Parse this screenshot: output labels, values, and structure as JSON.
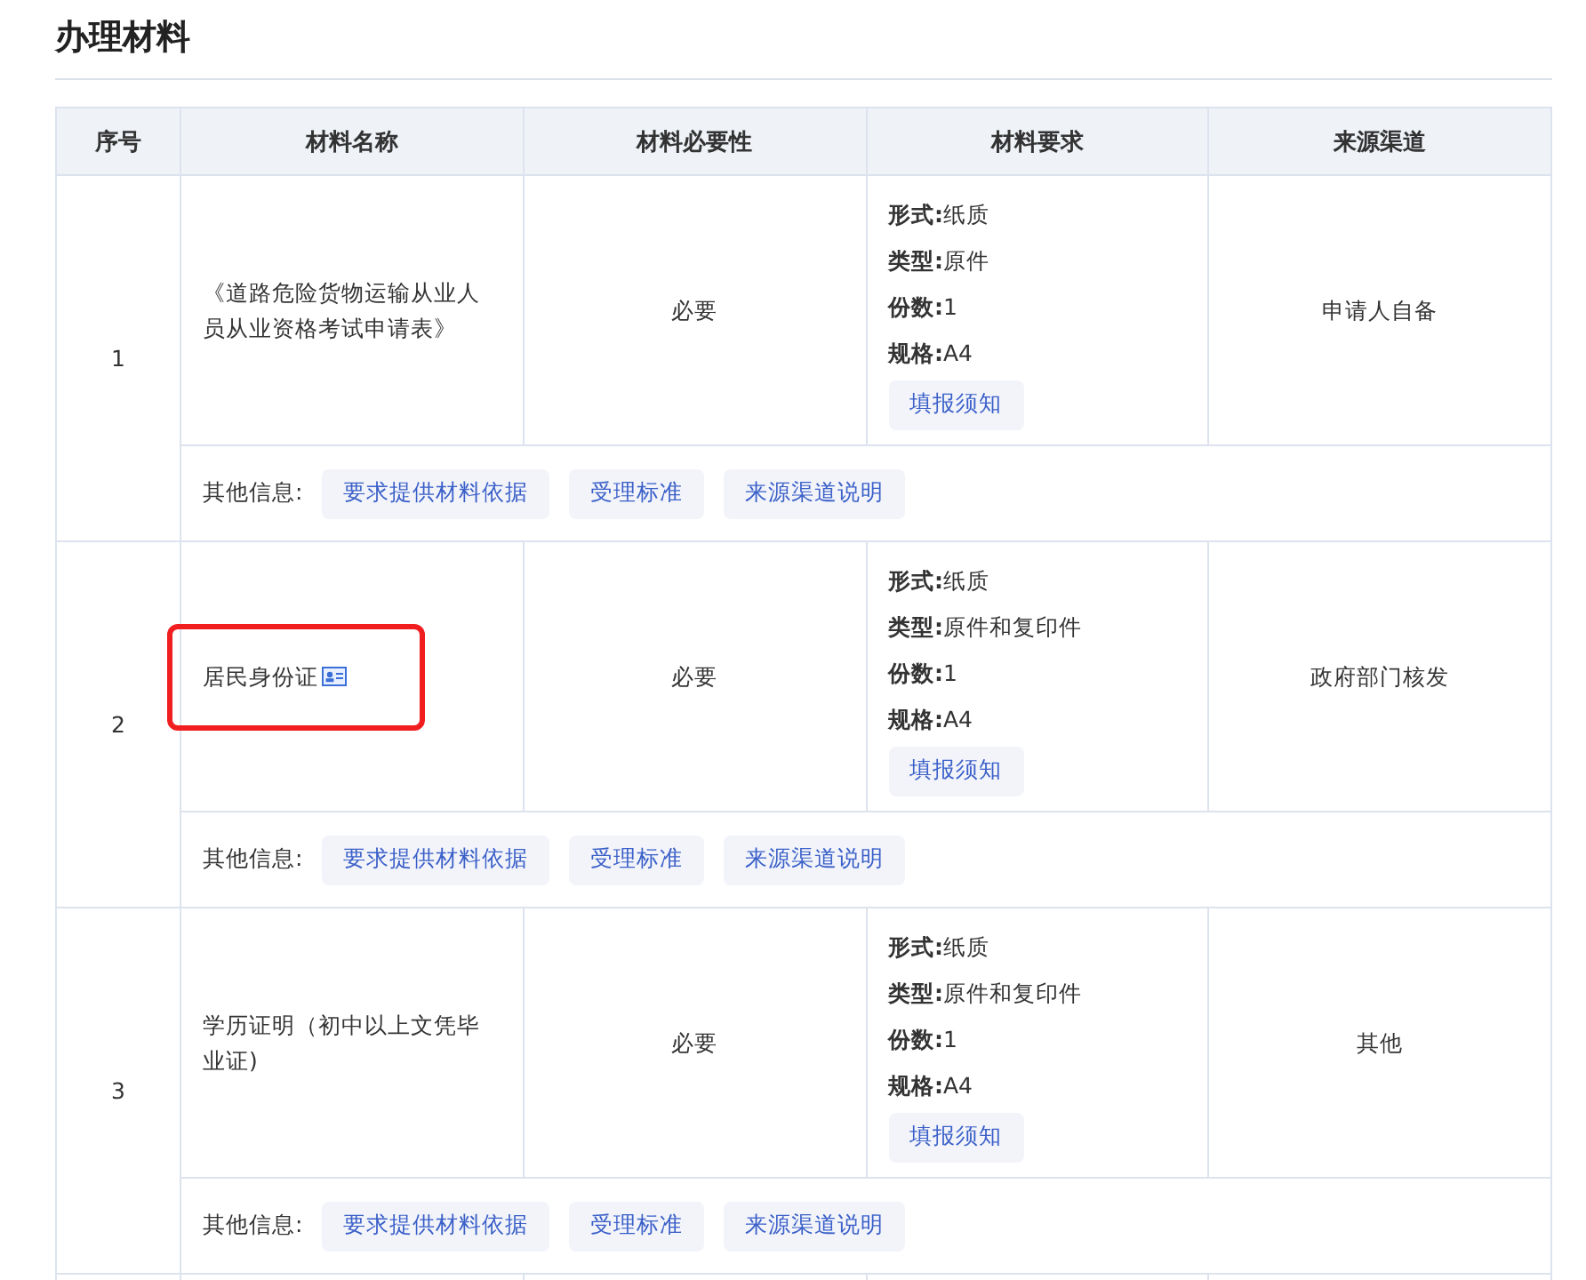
{
  "title": "办理材料",
  "table": {
    "columns": [
      "序号",
      "材料名称",
      "材料必要性",
      "材料要求",
      "来源渠道"
    ],
    "rows": [
      {
        "index": "1",
        "name": "《道路危险货物运输从业人员从业资格考试申请表》",
        "has_card_icon": false,
        "highlighted": false,
        "necessity": "必要",
        "requirements": [
          "**形式:**纸质",
          "**类型:**原件",
          "**份数:**1",
          "**规格:**A4"
        ],
        "notice_button": "填报须知",
        "source": "申请人自备",
        "other_label": "其他信息:",
        "other_buttons": [
          "要求提供材料依据",
          "受理标准",
          "来源渠道说明"
        ]
      },
      {
        "index": "2",
        "name": "居民身份证",
        "has_card_icon": true,
        "highlighted": true,
        "necessity": "必要",
        "requirements": [
          "**形式:**纸质",
          "**类型:**原件和复印件",
          "**份数:**1",
          "**规格:**A4"
        ],
        "notice_button": "填报须知",
        "source": "政府部门核发",
        "other_label": "其他信息:",
        "other_buttons": [
          "要求提供材料依据",
          "受理标准",
          "来源渠道说明"
        ]
      },
      {
        "index": "3",
        "name": "学历证明（初中以上文凭毕业证)",
        "has_card_icon": false,
        "highlighted": false,
        "necessity": "必要",
        "requirements": [
          "**形式:**纸质",
          "**类型:**原件和复印件",
          "**份数:**1",
          "**规格:**A4"
        ],
        "notice_button": "填报须知",
        "source": "其他",
        "other_label": "其他信息:",
        "other_buttons": [
          "要求提供材料依据",
          "受理标准",
          "来源渠道说明"
        ]
      }
    ]
  }
}
